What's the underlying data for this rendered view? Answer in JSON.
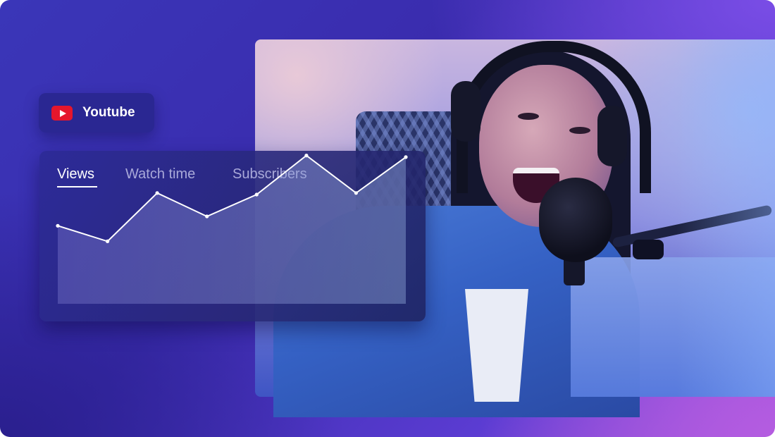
{
  "badge": {
    "label": "Youtube",
    "icon": "youtube-play-icon",
    "icon_color": "#e5162c"
  },
  "card": {
    "tabs": [
      {
        "label": "Views",
        "active": true
      },
      {
        "label": "Watch time",
        "active": false
      },
      {
        "label": "Subscribers",
        "active": false
      }
    ]
  },
  "chart_data": {
    "type": "area",
    "title": "",
    "xlabel": "",
    "ylabel": "",
    "x": [
      1,
      2,
      3,
      4,
      5,
      6,
      7,
      8
    ],
    "series": [
      {
        "values": [
          30,
          20,
          51,
          36,
          50,
          75,
          51,
          74
        ]
      }
    ],
    "ylim": [
      -20,
      78
    ],
    "grid": false,
    "line_color": "#ffffff"
  }
}
